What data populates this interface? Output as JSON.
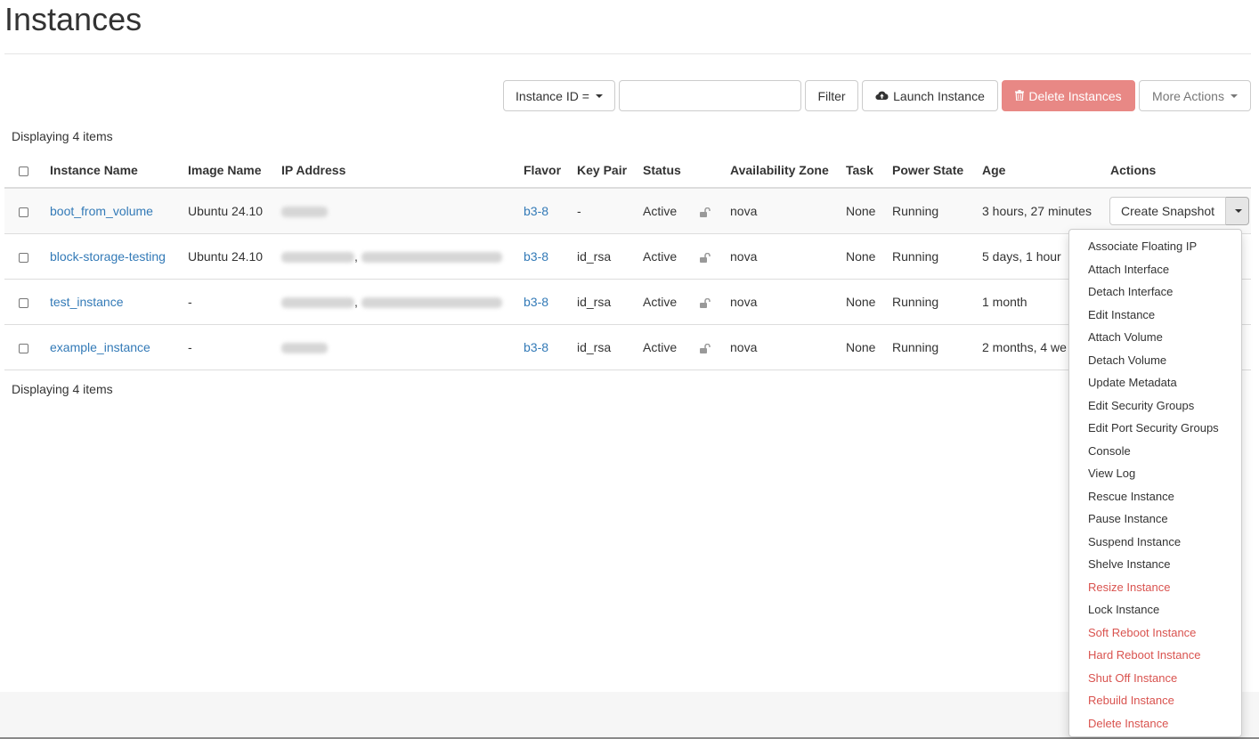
{
  "page": {
    "title": "Instances"
  },
  "toolbar": {
    "filter_field": "Instance ID =",
    "filter_input_value": "",
    "filter_button": "Filter",
    "launch_button": "Launch Instance",
    "delete_button": "Delete Instances",
    "more_actions": "More Actions"
  },
  "table": {
    "count_label": "Displaying 4 items",
    "headers": {
      "name": "Instance Name",
      "image": "Image Name",
      "ip": "IP Address",
      "flavor": "Flavor",
      "keypair": "Key Pair",
      "status": "Status",
      "az": "Availability Zone",
      "task": "Task",
      "power": "Power State",
      "age": "Age",
      "actions": "Actions"
    },
    "rows": [
      {
        "name": "boot_from_volume",
        "image": "Ubuntu 24.10",
        "ip_sep": "",
        "flavor": "b3-8",
        "keypair": "-",
        "status": "Active",
        "az": "nova",
        "task": "None",
        "power": "Running",
        "age": "3 hours, 27 minutes"
      },
      {
        "name": "block-storage-testing",
        "image": "Ubuntu 24.10",
        "ip_sep": ",",
        "flavor": "b3-8",
        "keypair": "id_rsa",
        "status": "Active",
        "az": "nova",
        "task": "None",
        "power": "Running",
        "age": "5 days, 1 hour"
      },
      {
        "name": "test_instance",
        "image": "-",
        "ip_sep": ",",
        "flavor": "b3-8",
        "keypair": "id_rsa",
        "status": "Active",
        "az": "nova",
        "task": "None",
        "power": "Running",
        "age": "1 month"
      },
      {
        "name": "example_instance",
        "image": "-",
        "ip_sep": "",
        "flavor": "b3-8",
        "keypair": "id_rsa",
        "status": "Active",
        "az": "nova",
        "task": "None",
        "power": "Running",
        "age": "2 months, 4 we"
      }
    ],
    "row_action": "Create Snapshot"
  },
  "menu": {
    "items": [
      {
        "label": "Associate Floating IP",
        "danger": false
      },
      {
        "label": "Attach Interface",
        "danger": false
      },
      {
        "label": "Detach Interface",
        "danger": false
      },
      {
        "label": "Edit Instance",
        "danger": false
      },
      {
        "label": "Attach Volume",
        "danger": false
      },
      {
        "label": "Detach Volume",
        "danger": false
      },
      {
        "label": "Update Metadata",
        "danger": false
      },
      {
        "label": "Edit Security Groups",
        "danger": false
      },
      {
        "label": "Edit Port Security Groups",
        "danger": false
      },
      {
        "label": "Console",
        "danger": false
      },
      {
        "label": "View Log",
        "danger": false
      },
      {
        "label": "Rescue Instance",
        "danger": false
      },
      {
        "label": "Pause Instance",
        "danger": false
      },
      {
        "label": "Suspend Instance",
        "danger": false
      },
      {
        "label": "Shelve Instance",
        "danger": false
      },
      {
        "label": "Resize Instance",
        "danger": true
      },
      {
        "label": "Lock Instance",
        "danger": false
      },
      {
        "label": "Soft Reboot Instance",
        "danger": true
      },
      {
        "label": "Hard Reboot Instance",
        "danger": true
      },
      {
        "label": "Shut Off Instance",
        "danger": true
      },
      {
        "label": "Rebuild Instance",
        "danger": true
      },
      {
        "label": "Delete Instance",
        "danger": true
      }
    ]
  },
  "colors": {
    "link": "#337ab7",
    "danger_button": "#e88885",
    "danger_text": "#d9534f"
  },
  "icons": {
    "launch": "cloud-upload-icon",
    "delete": "trash-icon",
    "lock": "unlocked-padlock-icon"
  }
}
